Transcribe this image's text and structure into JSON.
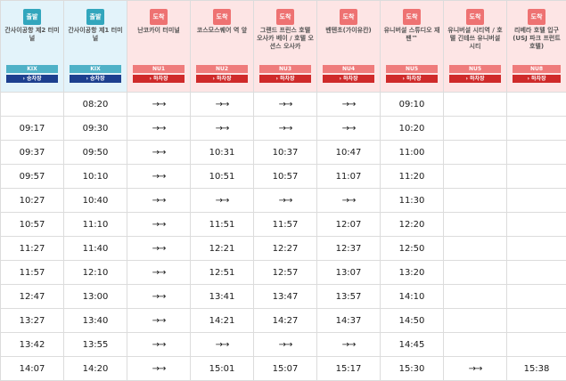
{
  "stops": [
    {
      "type": "dep",
      "badge": "출발",
      "name": "간사이공항 제2 터미널",
      "code": "KIX",
      "direction": "› 승차장"
    },
    {
      "type": "dep",
      "badge": "출발",
      "name": "간사이공항 제1 터미널",
      "code": "KIX",
      "direction": "› 승차장"
    },
    {
      "type": "arr",
      "badge": "도착",
      "name": "난코카이 터미널",
      "code": "NU1",
      "direction": "› 하차장"
    },
    {
      "type": "arr",
      "badge": "도착",
      "name": "코스모스퀘어 역 앞",
      "code": "NU2",
      "direction": "› 하차장"
    },
    {
      "type": "arr",
      "badge": "도착",
      "name": "그랜드 프린스 호텔 오사카 베이 / 호텔 오션스 오사카",
      "code": "NU3",
      "direction": "› 하차장"
    },
    {
      "type": "arr",
      "badge": "도착",
      "name": "벤텐초(가이유칸)",
      "code": "NU4",
      "direction": "› 하차장"
    },
    {
      "type": "arr",
      "badge": "도착",
      "name": "유니버설 스튜디오 재팬™",
      "code": "NU5",
      "direction": "› 하차장"
    },
    {
      "type": "arr",
      "badge": "도착",
      "name": "유니버설 시티역 / 호텔 긴테쓰 유니버설 시티",
      "code": "NU5",
      "direction": "› 하차장"
    },
    {
      "type": "arr",
      "badge": "도착",
      "name": "리베라 호텔 입구 (USJ 파크 프런트 호텔)",
      "code": "NU8",
      "direction": "› 하차장"
    }
  ],
  "rows": [
    [
      "",
      "08:20",
      "→→",
      "→→",
      "→→",
      "→→",
      "09:10",
      "",
      ""
    ],
    [
      "09:17",
      "09:30",
      "→→",
      "→→",
      "→→",
      "→→",
      "10:20",
      "",
      ""
    ],
    [
      "09:37",
      "09:50",
      "→→",
      "10:31",
      "10:37",
      "10:47",
      "11:00",
      "",
      ""
    ],
    [
      "09:57",
      "10:10",
      "→→",
      "10:51",
      "10:57",
      "11:07",
      "11:20",
      "",
      ""
    ],
    [
      "10:27",
      "10:40",
      "→→",
      "→→",
      "→→",
      "→→",
      "11:30",
      "",
      ""
    ],
    [
      "10:57",
      "11:10",
      "→→",
      "11:51",
      "11:57",
      "12:07",
      "12:20",
      "",
      ""
    ],
    [
      "11:27",
      "11:40",
      "→→",
      "12:21",
      "12:27",
      "12:37",
      "12:50",
      "",
      ""
    ],
    [
      "11:57",
      "12:10",
      "→→",
      "12:51",
      "12:57",
      "13:07",
      "13:20",
      "",
      ""
    ],
    [
      "12:47",
      "13:00",
      "→→",
      "13:41",
      "13:47",
      "13:57",
      "14:10",
      "",
      ""
    ],
    [
      "13:27",
      "13:40",
      "→→",
      "14:21",
      "14:27",
      "14:37",
      "14:50",
      "",
      ""
    ],
    [
      "13:42",
      "13:55",
      "→→",
      "→→",
      "→→",
      "→→",
      "14:45",
      "",
      ""
    ],
    [
      "14:07",
      "14:20",
      "→→",
      "15:01",
      "15:07",
      "15:17",
      "15:30",
      "→→",
      "15:38"
    ]
  ]
}
